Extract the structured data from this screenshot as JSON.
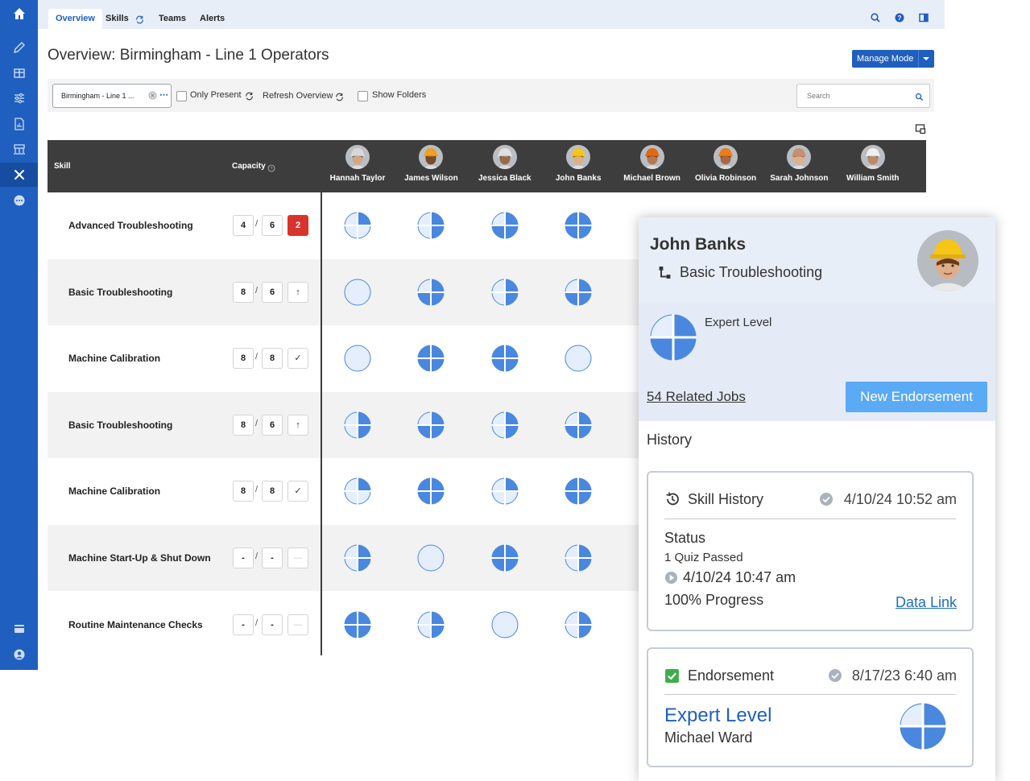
{
  "tabs": [
    {
      "label": "Overview"
    },
    {
      "label": "Skills"
    },
    {
      "label": "Teams"
    },
    {
      "label": "Alerts"
    }
  ],
  "header": {
    "title": "Overview: Birmingham - Line 1 Operators",
    "manage_mode_label": "Manage Mode"
  },
  "filters": {
    "group_value": "Birmingham - Line 1 ...",
    "only_present_label": "Only Present",
    "refresh_label": "Refresh Overview",
    "show_folders_label": "Show Folders",
    "search_placeholder": "Search"
  },
  "matrix": {
    "skill_header": "Skill",
    "capacity_header": "Capacity",
    "operators": [
      {
        "name": "Hannah Taylor",
        "skin": "#d9a57e",
        "hat": "#d8d8d8",
        "hair": "#3a2a20"
      },
      {
        "name": "James Wilson",
        "skin": "#7a4a2c",
        "hat": "#f0a020",
        "hair": "#222"
      },
      {
        "name": "Jessica Black",
        "skin": "#9a6a48",
        "hat": "#e0e0e0",
        "hair": "#2a1a10"
      },
      {
        "name": "John Banks",
        "skin": "#e0ae86",
        "hat": "#f5c518",
        "hair": "#6a3a1a"
      },
      {
        "name": "Michael Brown",
        "skin": "#b8784e",
        "hat": "#e06a10",
        "hair": "#222"
      },
      {
        "name": "Olivia Robinson",
        "skin": "#a86a44",
        "hat": "#ef7a18",
        "hair": "#222"
      },
      {
        "name": "Sarah Johnson",
        "skin": "#e0b08a",
        "hat": "#c89070",
        "hair": "#8a5a30"
      },
      {
        "name": "William Smith",
        "skin": "#c08a60",
        "hat": "#f0f0f0",
        "hair": "#333"
      }
    ],
    "rows": [
      {
        "skill": "Advanced Troubleshooting",
        "current": "4",
        "required": "6",
        "status": "2",
        "status_type": "alert",
        "levels": [
          1,
          2,
          3,
          4
        ]
      },
      {
        "skill": "Basic Troubleshooting",
        "current": "8",
        "required": "6",
        "status": "↑",
        "status_type": "up",
        "levels": [
          0,
          3,
          2,
          3
        ]
      },
      {
        "skill": "Machine Calibration",
        "current": "8",
        "required": "8",
        "status": "✓",
        "status_type": "ok",
        "levels": [
          0,
          4,
          4,
          0
        ]
      },
      {
        "skill": "Basic Troubleshooting",
        "current": "8",
        "required": "6",
        "status": "↑",
        "status_type": "up",
        "levels": [
          2,
          3,
          2,
          3
        ]
      },
      {
        "skill": "Machine Calibration",
        "current": "8",
        "required": "8",
        "status": "✓",
        "status_type": "ok",
        "levels": [
          1,
          4,
          1,
          4
        ]
      },
      {
        "skill": "Machine Start-Up & Shut Down",
        "current": "-",
        "required": "-",
        "status": "—",
        "status_type": "none",
        "levels": [
          2,
          0,
          4,
          2
        ]
      },
      {
        "skill": "Routine Maintenance Checks",
        "current": "-",
        "required": "-",
        "status": "—",
        "status_type": "none",
        "levels": [
          4,
          2,
          0,
          2
        ]
      }
    ]
  },
  "panel": {
    "operator_name": "John Banks",
    "skill": "Basic Troubleshooting",
    "level_label": "Expert Level",
    "level_value": 3,
    "related_jobs": "54 Related Jobs",
    "new_endorsement": "New Endorsement",
    "history_title": "History",
    "skill_history": {
      "title": "Skill History",
      "date": "4/10/24 10:52 am",
      "status_label": "Status",
      "quiz": "1 Quiz Passed",
      "quiz_date": "4/10/24 10:47 am",
      "progress": "100% Progress",
      "link": "Data Link"
    },
    "endorsement": {
      "title": "Endorsement",
      "date": "8/17/23 6:40 am",
      "level": "Expert Level",
      "by": "Michael Ward",
      "level_value": 3
    }
  },
  "colors": {
    "sidebar": "#1f5fbf",
    "accent": "#1f5fbf",
    "pie_fill": "#4a88e0",
    "pie_empty": "#e4eefc",
    "alert": "#d9342b",
    "button": "#5aaaf5"
  }
}
